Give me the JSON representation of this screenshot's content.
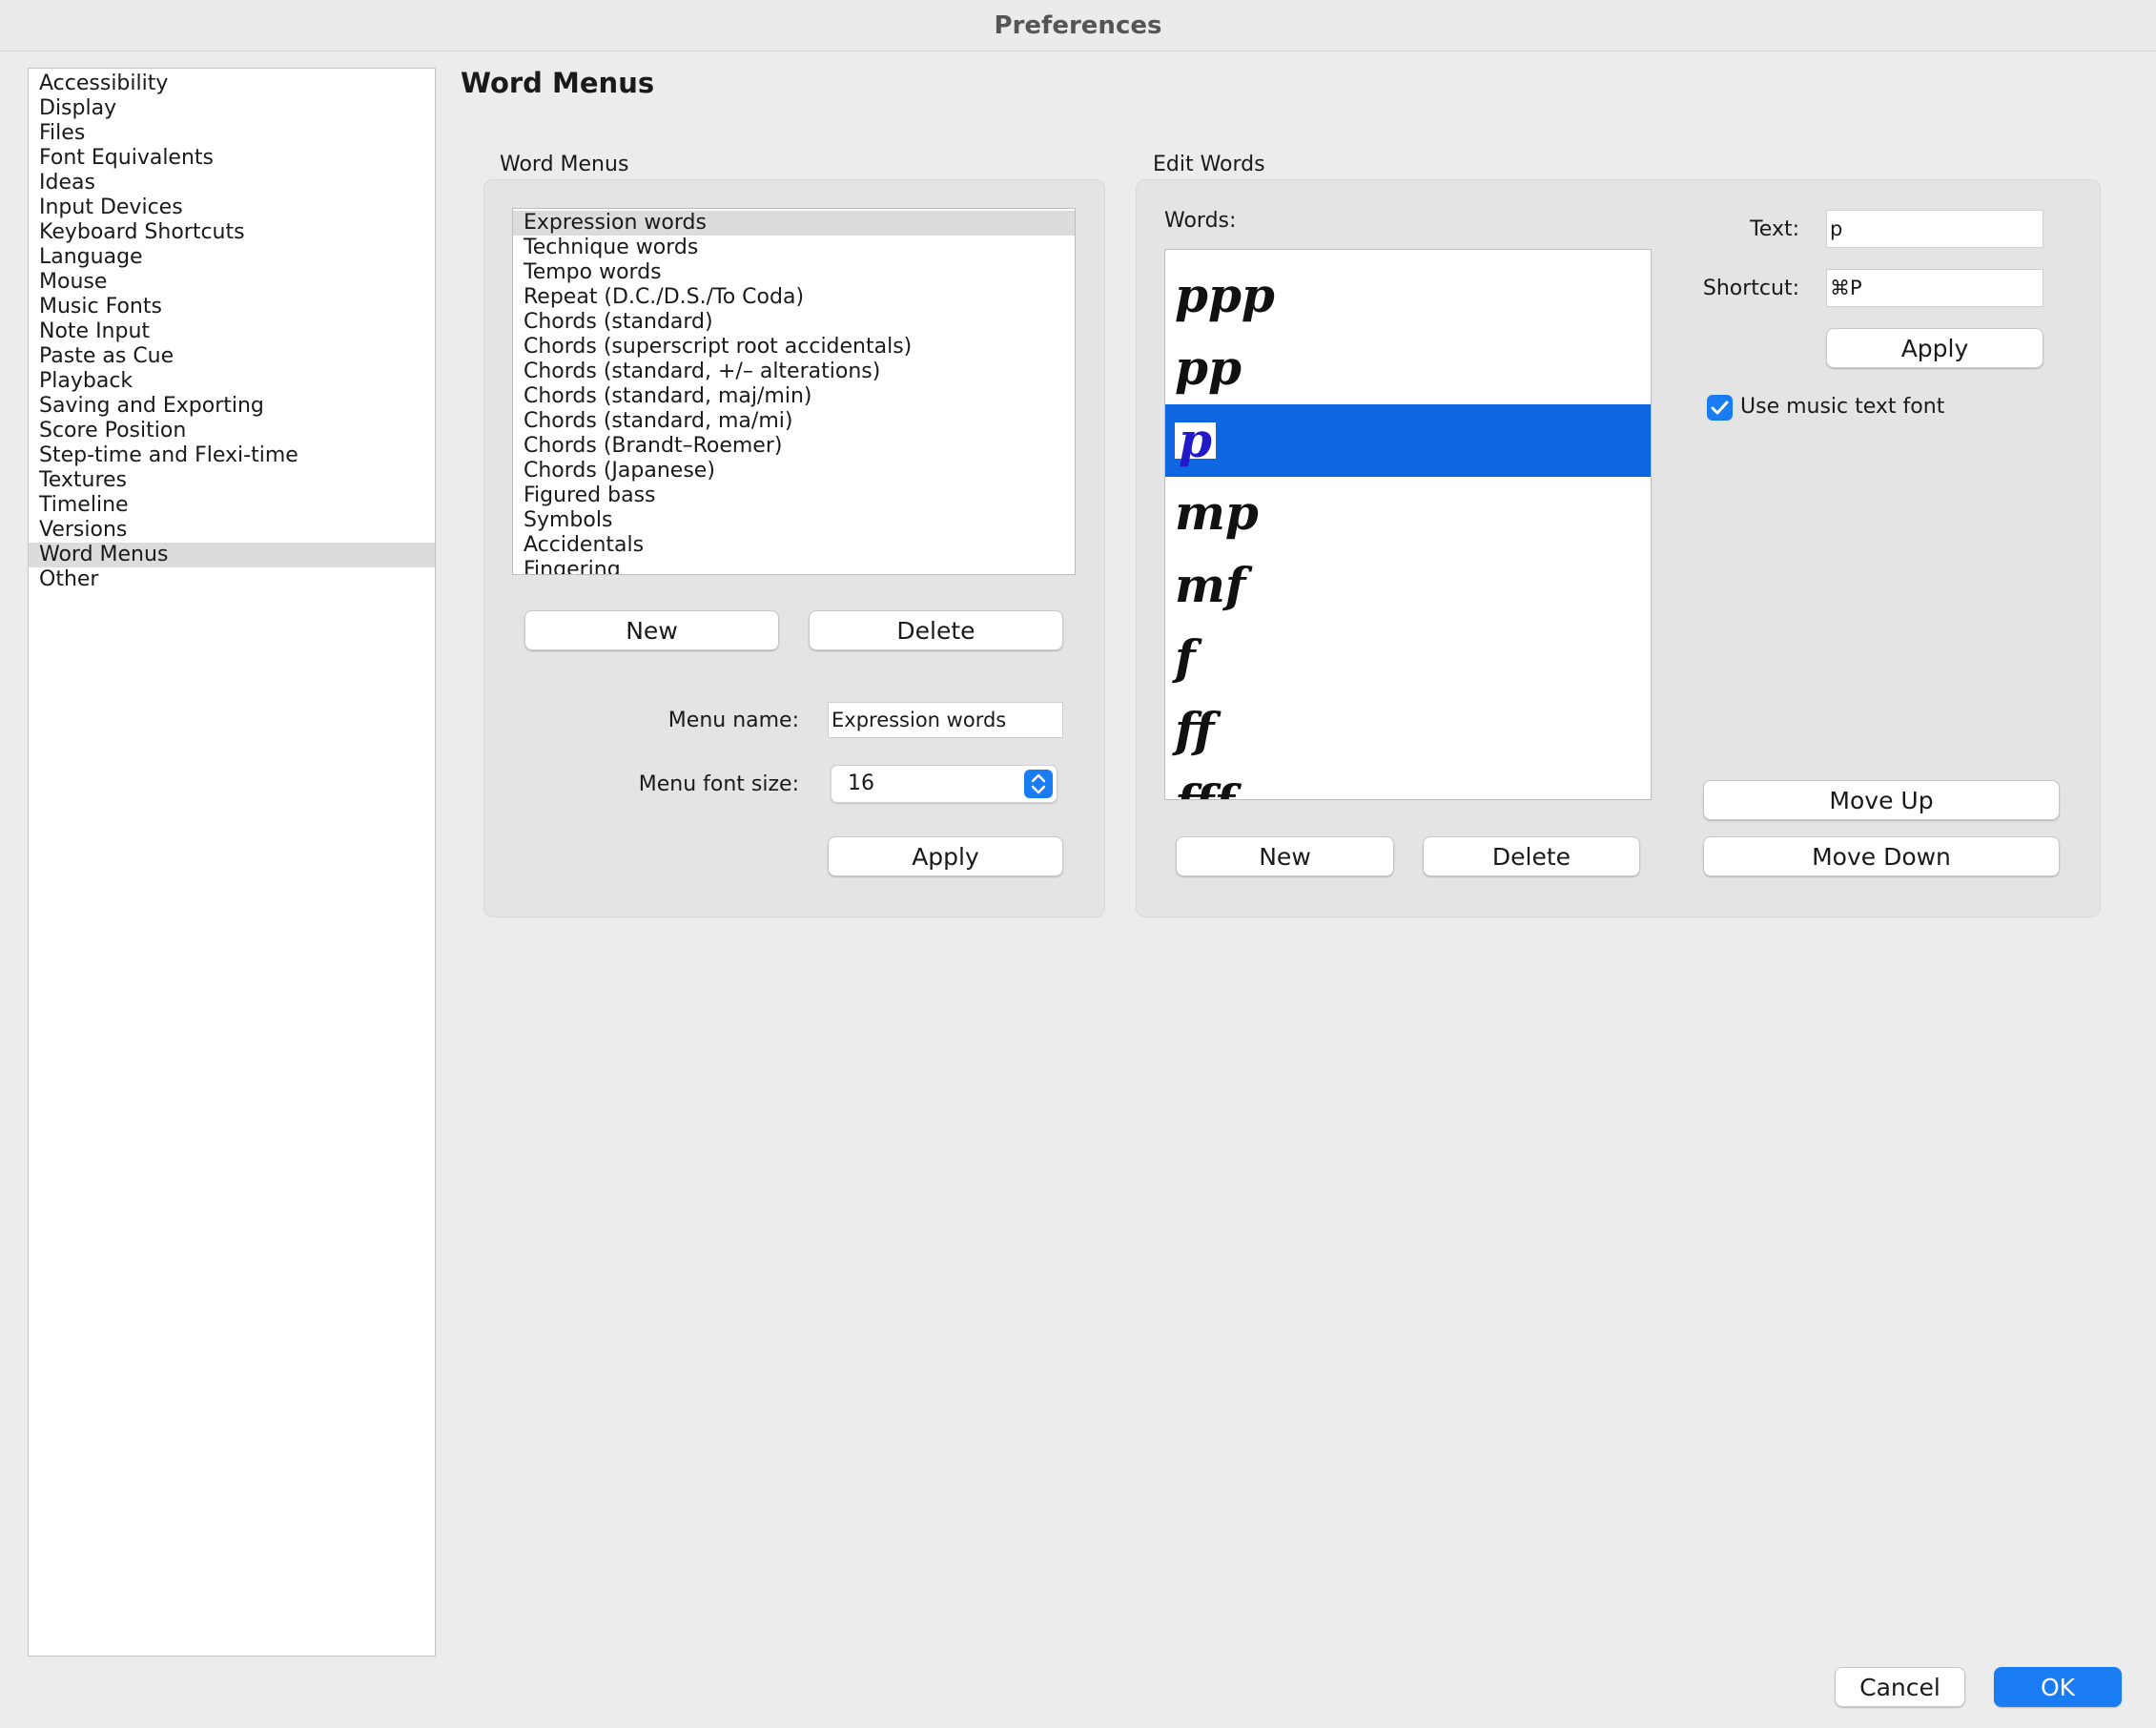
{
  "window": {
    "title": "Preferences"
  },
  "sidebar": {
    "items": [
      {
        "label": "Accessibility"
      },
      {
        "label": "Display"
      },
      {
        "label": "Files"
      },
      {
        "label": "Font Equivalents"
      },
      {
        "label": "Ideas"
      },
      {
        "label": "Input Devices"
      },
      {
        "label": "Keyboard Shortcuts"
      },
      {
        "label": "Language"
      },
      {
        "label": "Mouse"
      },
      {
        "label": "Music Fonts"
      },
      {
        "label": "Note Input"
      },
      {
        "label": "Paste as Cue"
      },
      {
        "label": "Playback"
      },
      {
        "label": "Saving and Exporting"
      },
      {
        "label": "Score Position"
      },
      {
        "label": "Step-time and Flexi-time"
      },
      {
        "label": "Textures"
      },
      {
        "label": "Timeline"
      },
      {
        "label": "Versions"
      },
      {
        "label": "Word Menus"
      },
      {
        "label": "Other"
      }
    ],
    "selected": "Word Menus"
  },
  "page": {
    "title": "Word Menus"
  },
  "word_menus": {
    "group_label": "Word Menus",
    "list": [
      "Expression words",
      "Technique words",
      "Tempo words",
      "Repeat (D.C./D.S./To Coda)",
      "Chords (standard)",
      "Chords (superscript root accidentals)",
      "Chords (standard, +/– alterations)",
      "Chords (standard, maj/min)",
      "Chords (standard, ma/mi)",
      "Chords (Brandt–Roemer)",
      "Chords (Japanese)",
      "Figured bass",
      "Symbols",
      "Accidentals",
      "Fingering"
    ],
    "selected": "Expression words",
    "new_label": "New",
    "delete_label": "Delete",
    "menu_name_label": "Menu name:",
    "menu_name_value": "Expression words",
    "menu_font_size_label": "Menu font size:",
    "menu_font_size_value": "16",
    "apply_label": "Apply"
  },
  "edit_words": {
    "group_label": "Edit Words",
    "words_label": "Words:",
    "words": [
      "ppp",
      "pp",
      "p",
      "mp",
      "mf",
      "f",
      "ff",
      "fff"
    ],
    "selected": "p",
    "text_label": "Text:",
    "text_value": "p",
    "shortcut_label": "Shortcut:",
    "shortcut_value": "⌘P",
    "apply_label": "Apply",
    "use_music_font_label": "Use music text font",
    "use_music_font_checked": true,
    "new_label": "New",
    "delete_label": "Delete",
    "move_up_label": "Move Up",
    "move_down_label": "Move Down"
  },
  "footer": {
    "cancel_label": "Cancel",
    "ok_label": "OK"
  },
  "colors": {
    "accent": "#1a7cf2",
    "selection": "#0e66e0"
  }
}
